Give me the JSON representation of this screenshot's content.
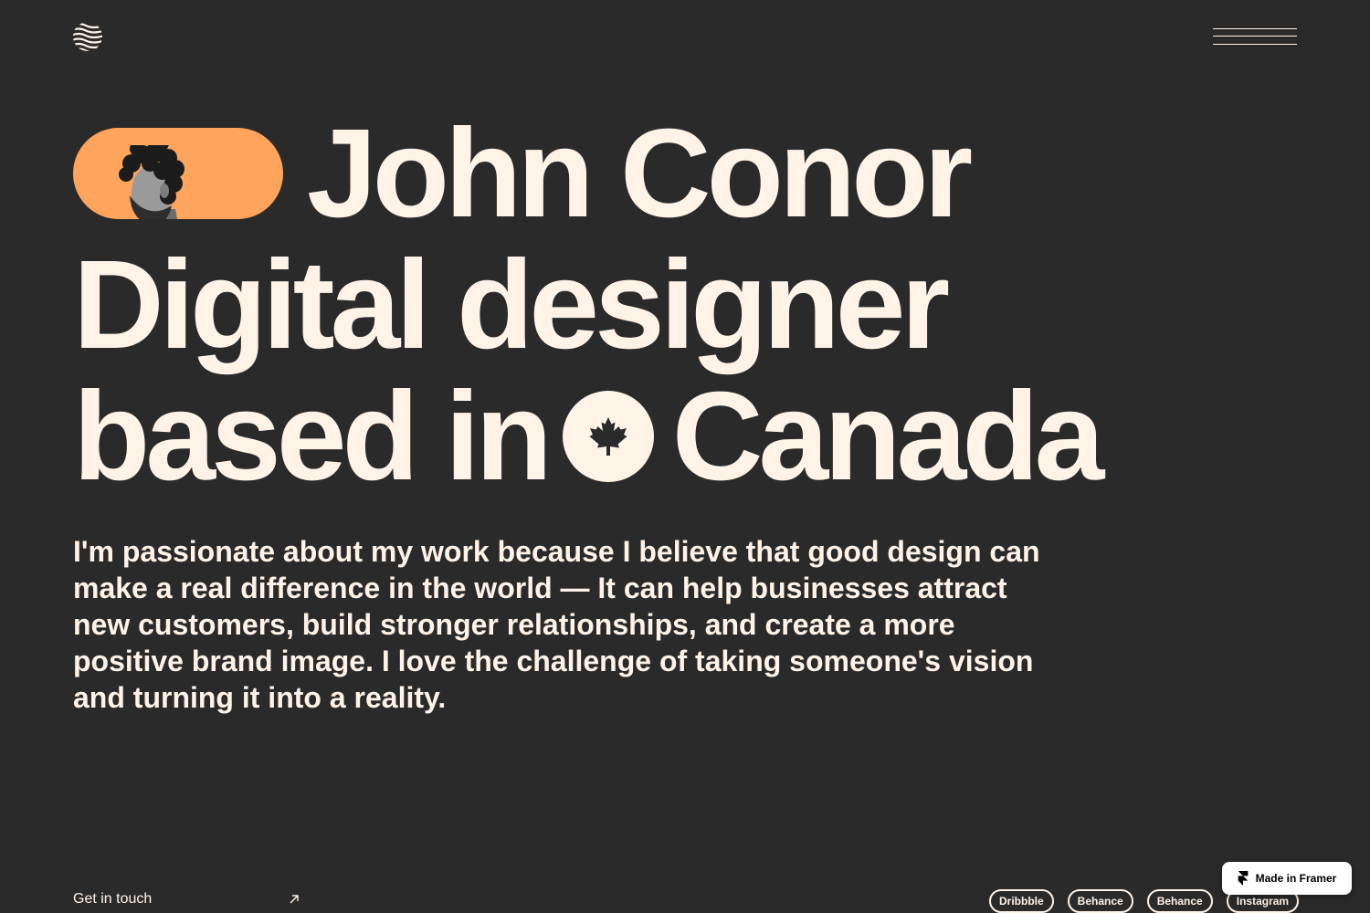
{
  "colors": {
    "background": "#2a2a2a",
    "text": "#fff3e8",
    "accent": "#ffa45c"
  },
  "header": {
    "logo_icon": "wave-logo-icon",
    "menu_icon": "hamburger-menu-icon"
  },
  "hero": {
    "name": "John Conor",
    "role": "Digital designer",
    "location_prefix": "based in",
    "location": "Canada",
    "avatar": "portrait-avatar",
    "flag_icon": "maple-leaf-icon"
  },
  "intro": "I'm passionate about my work because I believe that good design can make a real difference in the world — It can help businesses attract new customers, build stronger relationships, and create a more positive brand image. I love the challenge of taking someone's vision and turning it into a reality.",
  "footer": {
    "contact_label": "Get in touch",
    "contact_icon": "arrow-up-right-icon",
    "socials": [
      "Dribbble",
      "Behance",
      "Behance",
      "Instagram"
    ]
  },
  "framer_badge": {
    "label": "Made in Framer",
    "icon": "framer-logo-icon"
  }
}
